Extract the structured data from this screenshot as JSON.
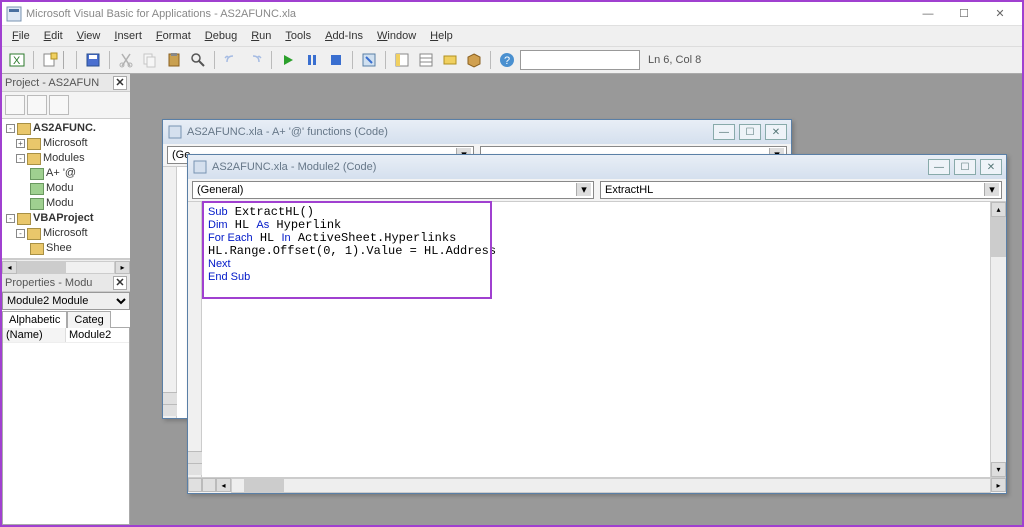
{
  "app": {
    "title": "Microsoft Visual Basic for Applications - AS2AFUNC.xla",
    "window_buttons": {
      "minimize": "—",
      "maximize": "☐",
      "close": "✕"
    }
  },
  "menu": [
    "File",
    "Edit",
    "View",
    "Insert",
    "Format",
    "Debug",
    "Run",
    "Tools",
    "Add-Ins",
    "Window",
    "Help"
  ],
  "toolbar": {
    "cursor_pos": "Ln 6, Col 8"
  },
  "project_pane": {
    "title": "Project - AS2AFUN",
    "items": [
      {
        "label": "AS2AFUNC.",
        "bold": true,
        "level": 0,
        "box": "-",
        "icon": "proj"
      },
      {
        "label": "Microsoft",
        "level": 1,
        "box": "+",
        "icon": "folder"
      },
      {
        "label": "Modules",
        "level": 1,
        "box": "-",
        "icon": "folder"
      },
      {
        "label": "A+ '@",
        "level": 2,
        "box": "",
        "icon": "mod"
      },
      {
        "label": "Modu",
        "level": 2,
        "box": "",
        "icon": "mod"
      },
      {
        "label": "Modu",
        "level": 2,
        "box": "",
        "icon": "mod"
      },
      {
        "label": "VBAProject",
        "bold": true,
        "level": 0,
        "box": "-",
        "icon": "proj"
      },
      {
        "label": "Microsoft",
        "level": 1,
        "box": "-",
        "icon": "folder"
      },
      {
        "label": "Shee",
        "level": 2,
        "box": "",
        "icon": "sheet"
      }
    ]
  },
  "properties_pane": {
    "title": "Properties - Modu",
    "object_selector": "Module2 Module",
    "tabs": [
      "Alphabetic",
      "Categ"
    ],
    "rows": [
      {
        "k": "(Name)",
        "v": "Module2"
      }
    ]
  },
  "child_windows": {
    "back": {
      "title": "AS2AFUNC.xla - A+ '@' functions (Code)"
    },
    "front": {
      "title": "AS2AFUNC.xla - Module2 (Code)",
      "dropdown_left": "(General)",
      "dropdown_right": "ExtractHL",
      "code_tokens": [
        [
          [
            "kw",
            "Sub"
          ],
          [
            "",
            " ExtractHL()"
          ]
        ],
        [
          [
            "kw",
            "Dim"
          ],
          [
            "",
            " HL "
          ],
          [
            "kw",
            "As"
          ],
          [
            "",
            " Hyperlink"
          ]
        ],
        [
          [
            "kw",
            "For Each"
          ],
          [
            "",
            " HL "
          ],
          [
            "kw",
            "In"
          ],
          [
            "",
            " ActiveSheet.Hyperlinks"
          ]
        ],
        [
          [
            "",
            "HL.Range.Offset(0, 1).Value = HL.Address"
          ]
        ],
        [
          [
            "kw",
            "Next"
          ]
        ],
        [
          [
            "kw",
            "End Sub"
          ]
        ]
      ]
    }
  }
}
